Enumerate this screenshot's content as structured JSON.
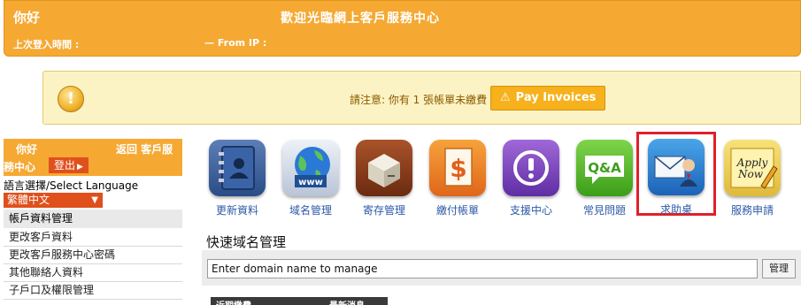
{
  "header": {
    "hello": "你好",
    "welcome": "歡迎光臨網上客戶服務中心",
    "last_login_label": "上次登入時間 :",
    "from_ip_label": "— From IP :"
  },
  "notice": {
    "icon": "exclamation-icon",
    "text": "請注意: 你有 1 張帳單未繳費",
    "pay_button": "Pay Invoices",
    "accent": "#f6b11c"
  },
  "sidebar": {
    "hello": "你好",
    "back": "返回 客戶服",
    "center": "務中心",
    "logout": "登出",
    "language_label": "語言選擇/Select Language",
    "language_selected": "繁體中文",
    "menu_header": "帳戶資料管理",
    "menu_items": [
      "更改客戶資料",
      "更改客戶服務中心密碼",
      "其他聯絡人資料",
      "子戶口及權限管理"
    ]
  },
  "icons": [
    {
      "label": "更新資料",
      "icon": "address-book-icon"
    },
    {
      "label": "域名管理",
      "icon": "globe-www-icon"
    },
    {
      "label": "寄存管理",
      "icon": "server-box-icon"
    },
    {
      "label": "繳付帳單",
      "icon": "invoice-dollar-icon"
    },
    {
      "label": "支援中心",
      "icon": "support-icon"
    },
    {
      "label": "常見問題",
      "icon": "qa-bubble-icon"
    },
    {
      "label": "求助桌",
      "icon": "helpdesk-mail-icon"
    },
    {
      "label": "服務申請",
      "icon": "apply-now-icon"
    }
  ],
  "quick_domain": {
    "title": "快速域名管理",
    "input_value": "Enter domain name to manage",
    "button": "管理"
  },
  "bottom_tabs": [
    "近期繳費",
    "",
    "最新消息"
  ],
  "colors": {
    "brand": "#f5a933",
    "logout": "#e0501c",
    "highlight": "#e0202a",
    "link": "#2d5aa8"
  }
}
